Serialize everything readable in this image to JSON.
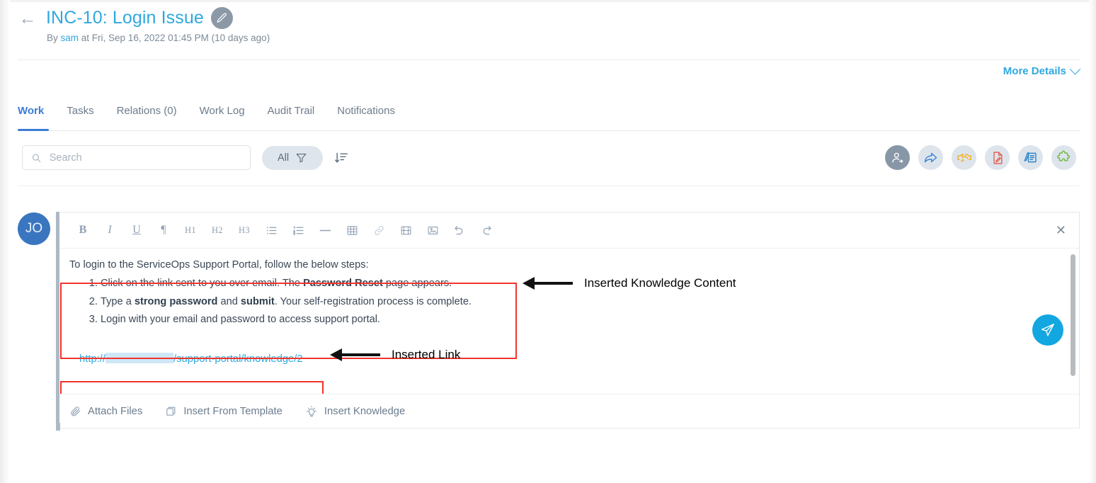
{
  "header": {
    "back_icon": "back-arrow-icon",
    "title": "INC-10: Login Issue",
    "edit_icon": "pencil-icon",
    "meta_prefix": "By ",
    "meta_user": "sam",
    "meta_suffix": " at Fri, Sep 16, 2022 01:45 PM (10 days ago)",
    "more_details": "More Details"
  },
  "tabs": [
    {
      "label": "Work",
      "active": true
    },
    {
      "label": "Tasks",
      "active": false
    },
    {
      "label": "Relations (0)",
      "active": false
    },
    {
      "label": "Work Log",
      "active": false
    },
    {
      "label": "Audit Trail",
      "active": false
    },
    {
      "label": "Notifications",
      "active": false
    }
  ],
  "filterbar": {
    "search_placeholder": "Search",
    "search_value": "",
    "search_icon": "search-icon",
    "filter_label": "All",
    "filter_icon": "funnel-icon",
    "sort_icon": "sort-descending-icon"
  },
  "actions": [
    {
      "name": "assign-user-icon",
      "color": "#ffffff",
      "bg": "#8897a7"
    },
    {
      "name": "forward-arrow-icon",
      "color": "#3b87d4",
      "bg": "#dde4ec"
    },
    {
      "name": "handshake-icon",
      "color": "#f4b223",
      "bg": "#dde4ec"
    },
    {
      "name": "document-edit-icon",
      "color": "#e05a4f",
      "bg": "#dde4ec"
    },
    {
      "name": "notes-edit-icon",
      "color": "#2f86c9",
      "bg": "#dde4ec"
    },
    {
      "name": "puzzle-piece-icon",
      "color": "#6cbb3c",
      "bg": "#dde4ec"
    }
  ],
  "composer": {
    "avatar_initials": "JO",
    "close_icon": "close-icon",
    "send_icon": "send-paper-plane-icon",
    "toolbar": [
      {
        "name": "bold-icon",
        "label": "B"
      },
      {
        "name": "italic-icon",
        "label": "I"
      },
      {
        "name": "underline-icon",
        "label": "U"
      },
      {
        "name": "paragraph-icon",
        "label": "¶"
      },
      {
        "name": "heading-1-icon",
        "label": "H1"
      },
      {
        "name": "heading-2-icon",
        "label": "H2"
      },
      {
        "name": "heading-3-icon",
        "label": "H3"
      },
      {
        "name": "bullet-list-icon",
        "label": ""
      },
      {
        "name": "numbered-list-icon",
        "label": ""
      },
      {
        "name": "horizontal-rule-icon",
        "label": ""
      },
      {
        "name": "table-icon",
        "label": ""
      },
      {
        "name": "link-icon",
        "label": ""
      },
      {
        "name": "video-icon",
        "label": ""
      },
      {
        "name": "image-icon",
        "label": ""
      },
      {
        "name": "undo-icon",
        "label": ""
      },
      {
        "name": "redo-icon",
        "label": ""
      }
    ],
    "content": {
      "intro": "To login to the ServiceOps Support Portal, follow the below steps:",
      "steps": [
        {
          "pre": "Click on the link sent to you over email. The ",
          "bold": "Password Reset",
          "post": " page appears."
        },
        {
          "pre": "Type a ",
          "bold": "strong password",
          "mid": " and ",
          "bold2": "submit",
          "post": ". Your self-registration process is complete."
        },
        {
          "pre": "Login with your email and password to access support portal.",
          "bold": "",
          "post": ""
        }
      ],
      "link_prefix": "http://",
      "link_redacted": "",
      "link_suffix": "/support-portal/knowledge/2"
    },
    "footer": [
      {
        "label": "Attach Files",
        "icon": "paperclip-icon"
      },
      {
        "label": "Insert From Template",
        "icon": "template-icon"
      },
      {
        "label": "Insert Knowledge",
        "icon": "lightbulb-icon"
      }
    ]
  },
  "annotations": [
    {
      "label": "Inserted Knowledge Content"
    },
    {
      "label": "Inserted Link"
    }
  ],
  "colors": {
    "title_blue": "#2fa8e0",
    "tab_active_blue": "#3b7dd8",
    "annotation_red": "#f0342c",
    "send_blue": "#12a7e0",
    "avatar_blue": "#3a76c0"
  }
}
